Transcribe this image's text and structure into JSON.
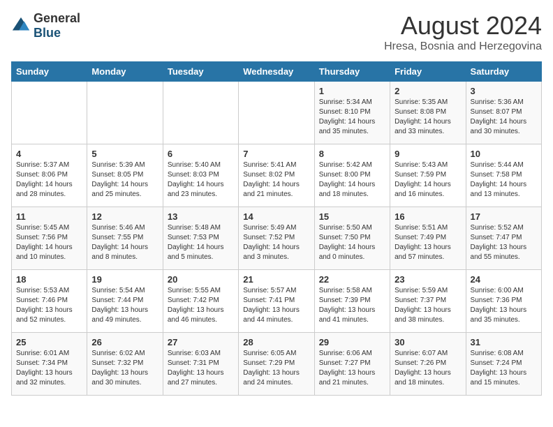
{
  "logo": {
    "text_general": "General",
    "text_blue": "Blue"
  },
  "title": "August 2024",
  "subtitle": "Hresa, Bosnia and Herzegovina",
  "days_of_week": [
    "Sunday",
    "Monday",
    "Tuesday",
    "Wednesday",
    "Thursday",
    "Friday",
    "Saturday"
  ],
  "weeks": [
    [
      {
        "day": "",
        "info": ""
      },
      {
        "day": "",
        "info": ""
      },
      {
        "day": "",
        "info": ""
      },
      {
        "day": "",
        "info": ""
      },
      {
        "day": "1",
        "info": "Sunrise: 5:34 AM\nSunset: 8:10 PM\nDaylight: 14 hours\nand 35 minutes."
      },
      {
        "day": "2",
        "info": "Sunrise: 5:35 AM\nSunset: 8:08 PM\nDaylight: 14 hours\nand 33 minutes."
      },
      {
        "day": "3",
        "info": "Sunrise: 5:36 AM\nSunset: 8:07 PM\nDaylight: 14 hours\nand 30 minutes."
      }
    ],
    [
      {
        "day": "4",
        "info": "Sunrise: 5:37 AM\nSunset: 8:06 PM\nDaylight: 14 hours\nand 28 minutes."
      },
      {
        "day": "5",
        "info": "Sunrise: 5:39 AM\nSunset: 8:05 PM\nDaylight: 14 hours\nand 25 minutes."
      },
      {
        "day": "6",
        "info": "Sunrise: 5:40 AM\nSunset: 8:03 PM\nDaylight: 14 hours\nand 23 minutes."
      },
      {
        "day": "7",
        "info": "Sunrise: 5:41 AM\nSunset: 8:02 PM\nDaylight: 14 hours\nand 21 minutes."
      },
      {
        "day": "8",
        "info": "Sunrise: 5:42 AM\nSunset: 8:00 PM\nDaylight: 14 hours\nand 18 minutes."
      },
      {
        "day": "9",
        "info": "Sunrise: 5:43 AM\nSunset: 7:59 PM\nDaylight: 14 hours\nand 16 minutes."
      },
      {
        "day": "10",
        "info": "Sunrise: 5:44 AM\nSunset: 7:58 PM\nDaylight: 14 hours\nand 13 minutes."
      }
    ],
    [
      {
        "day": "11",
        "info": "Sunrise: 5:45 AM\nSunset: 7:56 PM\nDaylight: 14 hours\nand 10 minutes."
      },
      {
        "day": "12",
        "info": "Sunrise: 5:46 AM\nSunset: 7:55 PM\nDaylight: 14 hours\nand 8 minutes."
      },
      {
        "day": "13",
        "info": "Sunrise: 5:48 AM\nSunset: 7:53 PM\nDaylight: 14 hours\nand 5 minutes."
      },
      {
        "day": "14",
        "info": "Sunrise: 5:49 AM\nSunset: 7:52 PM\nDaylight: 14 hours\nand 3 minutes."
      },
      {
        "day": "15",
        "info": "Sunrise: 5:50 AM\nSunset: 7:50 PM\nDaylight: 14 hours\nand 0 minutes."
      },
      {
        "day": "16",
        "info": "Sunrise: 5:51 AM\nSunset: 7:49 PM\nDaylight: 13 hours\nand 57 minutes."
      },
      {
        "day": "17",
        "info": "Sunrise: 5:52 AM\nSunset: 7:47 PM\nDaylight: 13 hours\nand 55 minutes."
      }
    ],
    [
      {
        "day": "18",
        "info": "Sunrise: 5:53 AM\nSunset: 7:46 PM\nDaylight: 13 hours\nand 52 minutes."
      },
      {
        "day": "19",
        "info": "Sunrise: 5:54 AM\nSunset: 7:44 PM\nDaylight: 13 hours\nand 49 minutes."
      },
      {
        "day": "20",
        "info": "Sunrise: 5:55 AM\nSunset: 7:42 PM\nDaylight: 13 hours\nand 46 minutes."
      },
      {
        "day": "21",
        "info": "Sunrise: 5:57 AM\nSunset: 7:41 PM\nDaylight: 13 hours\nand 44 minutes."
      },
      {
        "day": "22",
        "info": "Sunrise: 5:58 AM\nSunset: 7:39 PM\nDaylight: 13 hours\nand 41 minutes."
      },
      {
        "day": "23",
        "info": "Sunrise: 5:59 AM\nSunset: 7:37 PM\nDaylight: 13 hours\nand 38 minutes."
      },
      {
        "day": "24",
        "info": "Sunrise: 6:00 AM\nSunset: 7:36 PM\nDaylight: 13 hours\nand 35 minutes."
      }
    ],
    [
      {
        "day": "25",
        "info": "Sunrise: 6:01 AM\nSunset: 7:34 PM\nDaylight: 13 hours\nand 32 minutes."
      },
      {
        "day": "26",
        "info": "Sunrise: 6:02 AM\nSunset: 7:32 PM\nDaylight: 13 hours\nand 30 minutes."
      },
      {
        "day": "27",
        "info": "Sunrise: 6:03 AM\nSunset: 7:31 PM\nDaylight: 13 hours\nand 27 minutes."
      },
      {
        "day": "28",
        "info": "Sunrise: 6:05 AM\nSunset: 7:29 PM\nDaylight: 13 hours\nand 24 minutes."
      },
      {
        "day": "29",
        "info": "Sunrise: 6:06 AM\nSunset: 7:27 PM\nDaylight: 13 hours\nand 21 minutes."
      },
      {
        "day": "30",
        "info": "Sunrise: 6:07 AM\nSunset: 7:26 PM\nDaylight: 13 hours\nand 18 minutes."
      },
      {
        "day": "31",
        "info": "Sunrise: 6:08 AM\nSunset: 7:24 PM\nDaylight: 13 hours\nand 15 minutes."
      }
    ]
  ]
}
